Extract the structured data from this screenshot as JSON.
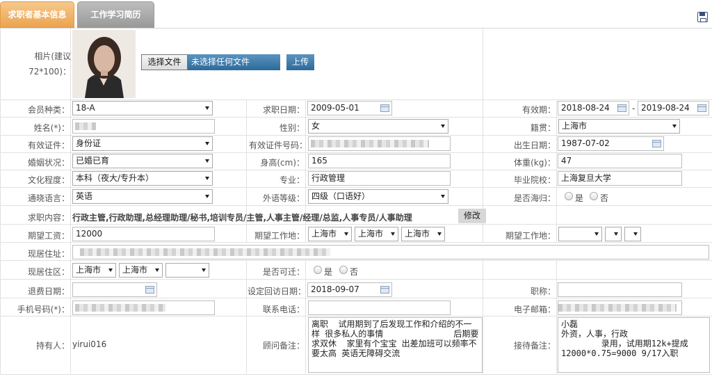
{
  "tabs": [
    {
      "label": "求职者基本信息",
      "active": true
    },
    {
      "label": "工作学习简历",
      "active": false
    }
  ],
  "photo": {
    "label": "相片(建议72*100)：",
    "choose_file": "选择文件",
    "no_file": "未选择任何文件",
    "upload": "上传"
  },
  "membership": {
    "label": "会员种类：",
    "value": "18-A"
  },
  "apply_date": {
    "label": "求职日期：",
    "value": "2009-05-01"
  },
  "validity": {
    "label": "有效期：",
    "from": "2018-08-24",
    "sep": "-",
    "to": "2019-08-24"
  },
  "name": {
    "label": "姓名(*)："
  },
  "gender": {
    "label": "性别：",
    "value": "女"
  },
  "native": {
    "label": "籍贯：",
    "value": "上海市"
  },
  "id_type": {
    "label": "有效证件：",
    "value": "身份证"
  },
  "id_number": {
    "label": "有效证件号码："
  },
  "birth_date": {
    "label": "出生日期：",
    "value": "1987-07-02"
  },
  "marital": {
    "label": "婚姻状况：",
    "value": "已婚已育"
  },
  "height": {
    "label": "身高(cm)：",
    "value": "165"
  },
  "weight": {
    "label": "体重(kg)：",
    "value": "47"
  },
  "education": {
    "label": "文化程度：",
    "value": "本科（夜大/专升本）"
  },
  "major": {
    "label": "专业：",
    "value": "行政管理"
  },
  "school": {
    "label": "毕业院校：",
    "value": "上海复旦大学"
  },
  "language": {
    "label": "通晓语言：",
    "value": "英语"
  },
  "language_level": {
    "label": "外语等级：",
    "value": "四级（口语好）"
  },
  "overseas": {
    "label": "是否海归：",
    "yes": "是",
    "no": "否"
  },
  "job_content": {
    "label": "求职内容：",
    "value": "行政主管,行政助理,总经理助理/秘书,培训专员/主管,人事主管/经理/总监,人事专员/人事助理",
    "edit": "修改"
  },
  "salary": {
    "label": "期望工资：",
    "value": "12000"
  },
  "work_loc1": {
    "label": "期望工作地：",
    "values": [
      "上海市",
      "上海市",
      "上海市"
    ]
  },
  "work_loc2": {
    "label": "期望工作地："
  },
  "address": {
    "label": "现居住址："
  },
  "district": {
    "label": "现居住区：",
    "values": [
      "上海市",
      "上海市"
    ]
  },
  "relocate": {
    "label": "是否可迁：",
    "yes": "是",
    "no": "否"
  },
  "refund_date": {
    "label": "退费日期："
  },
  "visit_date": {
    "label": "设定回访日期：",
    "value": "2018-09-07"
  },
  "job_title": {
    "label": "职称："
  },
  "mobile": {
    "label": "手机号码(*)："
  },
  "phone": {
    "label": "联系电话："
  },
  "email": {
    "label": "电子邮箱："
  },
  "holder": {
    "label": "持有人：",
    "value": "yirui016"
  },
  "advisor_note": {
    "label": "顾问备注：",
    "value": "离职  试用期到了后发现工作和介绍的不一样 很多私人的事情              后期要求双休  家里有个宝宝 出差加班可以频率不要太高 英语无障碍交流"
  },
  "reception_note": {
    "label": "接待备注：",
    "value": "小磊\n外资，人事，行政\n        录用，试用期12k+提成\n12000*0.75=9000 9/17入职"
  }
}
